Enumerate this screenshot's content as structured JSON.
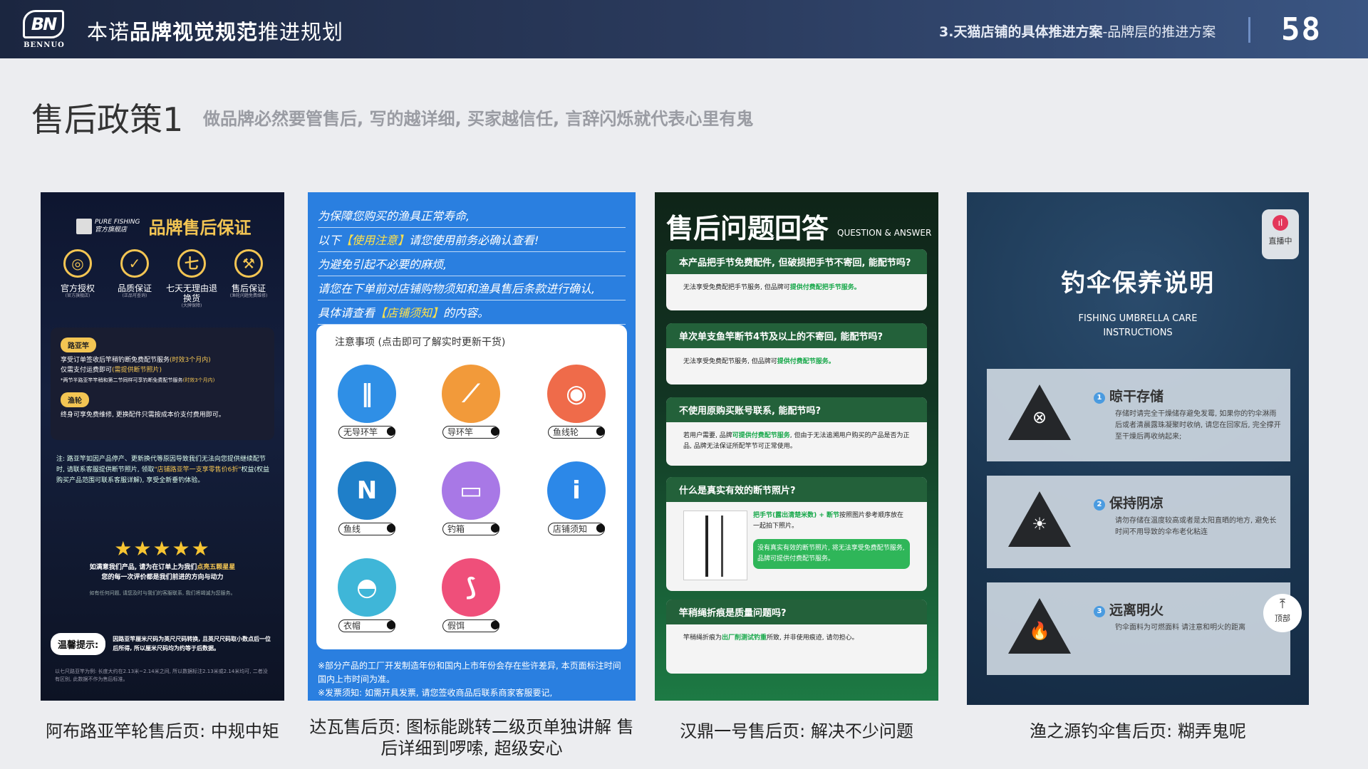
{
  "header": {
    "logo_text": "BENNUO",
    "logo_mark": "BN",
    "title_prefix": "本诺",
    "title_bold": "品牌视觉规范",
    "title_suffix": "推进规划",
    "sub_bold": "3.天猫店铺的具体推进方案",
    "sub_rest": "-品牌层的推进方案",
    "page_num": "58"
  },
  "section": {
    "title": "售后政策1",
    "subtitle": "做品牌必然要管售后, 写的越详细, 买家越信任, 言辞闪烁就代表心里有鬼"
  },
  "panel1": {
    "shop_name_1": "PURE FISHING",
    "shop_name_2": "官方旗舰店",
    "brand_title": "品牌售后保证",
    "icons": [
      {
        "label": "官方授权",
        "small": "(官方旗舰店)",
        "glyph": "◎"
      },
      {
        "label": "品质保证",
        "small": "(正品可查询)",
        "glyph": "✓"
      },
      {
        "label": "七天无理由退换货",
        "small": "(大牌保障)",
        "glyph": "七"
      },
      {
        "label": "售后保证",
        "small": "(渔轮问题免费维修)",
        "glyph": "⚒"
      }
    ],
    "tag1": "路亚竿",
    "line1a": "享受订单签收后竿稍钓断免费配节服务",
    "line1a_hl": "(时效3个月内)",
    "line1b": "仅需支付运费即可",
    "line1b_hl": "(需提供断节照片)",
    "line1c": "*两节半路亚竿竿稍和第二节同样可享钓断免费配节服务",
    "line1c_hl": "(时效3个月内)",
    "tag2": "渔轮",
    "line2": "终身可享免费维修, 更换配件只需按成本价支付费用即可。",
    "note_a": "注: 路亚竿如因产品停产、更新换代等原因导致我们无法向您提供继续配节时, 请联系客服提供断节照片, 领取",
    "note_hl": "\"店铺路亚竿一支享零售价6折\"",
    "note_b": "权益(权益购买产品范围可联系客服详解), 享受全新垂钓体验。",
    "stars": "★★★★★",
    "rate1a": "如满意我们产品, 请为在订单上为我们",
    "rate1_hl": "点亮五颗星星",
    "rate1b": "您的每一次评价都是我们前进的方向与动力",
    "rate2": "如有任何问题, 请您及时与我们的客服联系, 我们将竭诚为您服务。",
    "warm_tag": "温馨提示:",
    "warm_text": "因路亚竿厘米尺码为英尺尺码转换, 且英尺尺码取小数点后一位后所得, 所以厘米尺码均为约等于后数据。",
    "foot": "以七尺路亚竿为例: 长度大约在2.13米~2.14米之间, 所以数据标注2.13米或2.14米均可, 二者没有区别, 此数据不作为售后标准。",
    "caption": "阿布路亚竿轮售后页: 中规中矩"
  },
  "panel2": {
    "lines": [
      {
        "a": "为保障您购买的渔具正常寿命,",
        "hl": "",
        "b": ""
      },
      {
        "a": "以下",
        "hl": "【使用注意】",
        "b": "请您使用前务必确认查看!"
      },
      {
        "a": "为避免引起不必要的麻烦,",
        "hl": "",
        "b": ""
      },
      {
        "a": "请您在下单前对店铺购物须知和渔具售后条款进行确认,",
        "hl": "",
        "b": ""
      },
      {
        "a": "具体请查看",
        "hl": "【店铺须知】",
        "b": "的内容。"
      }
    ],
    "card_title": "注意事项 (点击即可了解实时更新干货)",
    "items": [
      {
        "label": "无导环竿",
        "glyph": "‖",
        "color": "#2f8fe6"
      },
      {
        "label": "导环竿",
        "glyph": "⟋",
        "color": "#f29a3a"
      },
      {
        "label": "鱼线轮",
        "glyph": "◉",
        "color": "#ef6b4a"
      },
      {
        "label": "鱼线",
        "glyph": "N",
        "color": "#1f7fc9"
      },
      {
        "label": "钓箱",
        "glyph": "▭",
        "color": "#a878e6"
      },
      {
        "label": "店铺须知",
        "glyph": "i",
        "color": "#2c88e8"
      },
      {
        "label": "衣帽",
        "glyph": "◓",
        "color": "#3fb6d8"
      },
      {
        "label": "假饵",
        "glyph": "⟆",
        "color": "#ef4f7a"
      }
    ],
    "foot1": "※部分产品的工厂开发制造年份和国内上市年份会存在些许差异, 本页面标注时间国内上市时间为准。",
    "foot2": "※发票须知: 如需开具发票, 请您签收商品后联系商家客服要记,",
    "caption": "达瓦售后页: 图标能跳转二级页单独讲解 售后详细到啰嗦, 超级安心"
  },
  "panel3": {
    "title": "售后问题回答",
    "qa_en": "QUESTION & ANSWER",
    "q1": "本产品把手节免费配件, 但破损把手节不寄回, 能配节吗?",
    "a1": "无法享受免费配把手节服务, 但品牌可",
    "a1_hl": "提供付费配把手节服务。",
    "q2": "单次单支鱼竿断节4节及以上的不寄回, 能配节吗?",
    "a2": "无法享受免费配节服务, 但品牌可",
    "a2_hl": "提供付费配节服务。",
    "q3": "不使用原购买账号联系, 能配节吗?",
    "a3a": "若用户需要, 品牌",
    "a3_hl": "可提供付费配节服务",
    "a3b": ", 但由于无法追溯用户购买的产品是否为正品, 品牌无法保证所配竿节可正常使用。",
    "q4": "什么是真实有效的断节照片?",
    "a4_hl": "把手节(露出清楚米数) + 断节",
    "a4": "按照图片参考顺序放在一起拍下照片。",
    "a4_box": "没有真实有效的断节照片, 将无法享受免费配节服务, 品牌可提供付费配节服务。",
    "q5": "竿稍绳折痕是质量问题吗?",
    "a5a": "竿稍绳折痕为",
    "a5_hl": "出厂削测试钓重",
    "a5b": "所致, 并非使用痕迹, 请勿担心。",
    "caption": "汉鼎一号售后页: 解决不少问题"
  },
  "panel4": {
    "live": "直播中",
    "title": "钓伞保养说明",
    "en1": "FISHING UMBRELLA CARE",
    "en2": "INSTRUCTIONS",
    "cards": [
      {
        "num": "1",
        "title": "晾干存储",
        "icon": "⊗",
        "body": "存储时请完全干燥储存避免发霉, 如果你的钓伞淋雨后或者清晨露珠凝聚时收纳, 请您在回家后, 完全撑开至干燥后再收纳起来;"
      },
      {
        "num": "2",
        "title": "保持阴凉",
        "icon": "☀",
        "body": "请勿存储在温度较高或者是太阳直晒的地方, 避免长时间不用导致的伞布老化粘连"
      },
      {
        "num": "3",
        "title": "远离明火",
        "icon": "🔥",
        "body": "钓伞面料为可燃面料 请注意和明火的距离"
      }
    ],
    "top": "顶部",
    "caption": "渔之源钓伞售后页: 糊弄鬼呢"
  }
}
